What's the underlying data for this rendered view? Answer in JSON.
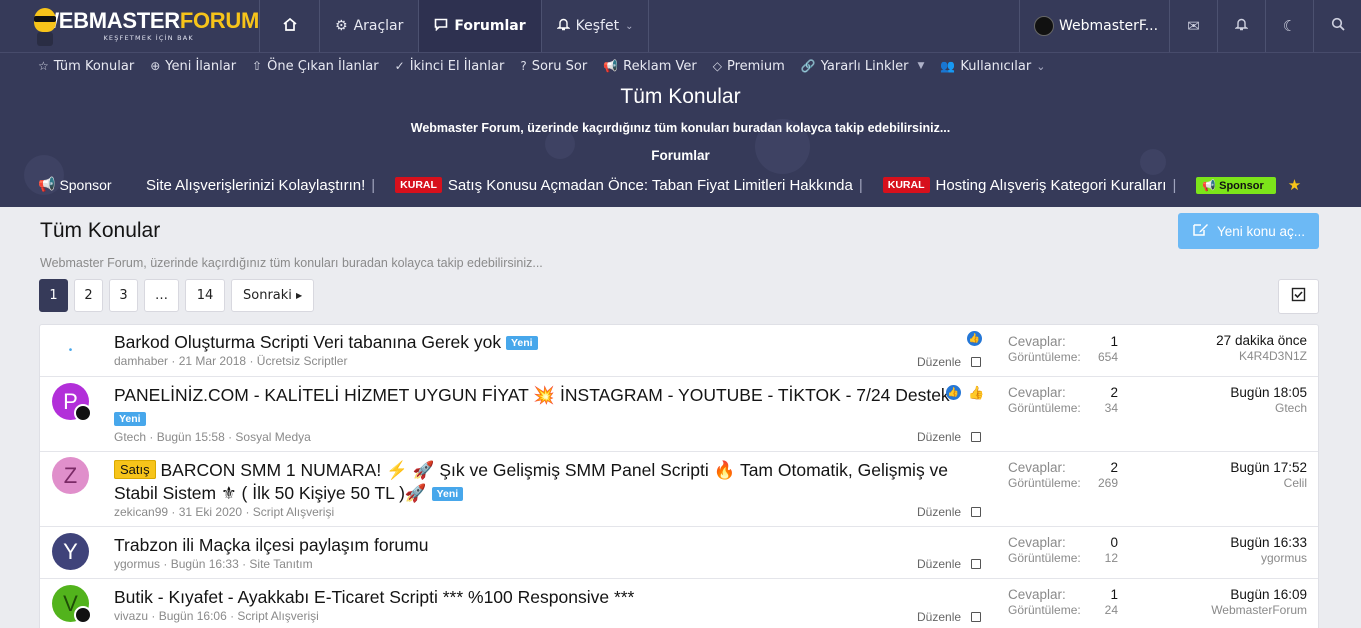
{
  "header": {
    "logo": {
      "part1": "WEBMASTER",
      "part2": "FORUM",
      "tagline": "KEŞFETMEK İÇİN BAK"
    },
    "nav": [
      {
        "label": "Araçlar"
      },
      {
        "label": "Forumlar"
      },
      {
        "label": "Keşfet"
      }
    ],
    "user": "WebmasterF..."
  },
  "subnav": [
    {
      "label": "Tüm Konular",
      "icon": "star-outline-icon"
    },
    {
      "label": "Yeni İlanlar",
      "icon": "plus-circle-icon"
    },
    {
      "label": "Öne Çıkan İlanlar",
      "icon": "arrow-up-circle-icon"
    },
    {
      "label": "İkinci El İlanlar",
      "icon": "check-circle-icon"
    },
    {
      "label": "Soru Sor",
      "icon": "question-circle-icon"
    },
    {
      "label": "Reklam Ver",
      "icon": "megaphone-icon"
    },
    {
      "label": "Premium",
      "icon": "diamond-icon"
    },
    {
      "label": "Yararlı Linkler",
      "icon": "link-icon"
    },
    {
      "label": "Kullanıcılar",
      "icon": "users-icon"
    }
  ],
  "hero": {
    "title": "Tüm Konular",
    "description": "Webmaster Forum, üzerinde kaçırdığınız tüm konuları buradan kolayca takip edebilirsiniz...",
    "breadcrumb": "Forumlar"
  },
  "ticker": {
    "sponsor_label": "Sponsor",
    "items": [
      {
        "text": "Site Alışverişlerinizi Kolaylaştırın!"
      },
      {
        "badge": "KURAL",
        "text": "Satış Konusu Açmadan Önce: Taban Fiyat Limitleri Hakkında"
      },
      {
        "badge": "KURAL",
        "text": "Hosting Alışveriş Kategori Kuralları"
      }
    ],
    "sponsor_badge": "Sponsor"
  },
  "page": {
    "title": "Tüm Konular",
    "description": "Webmaster Forum, üzerinde kaçırdığınız tüm konuları buradan kolayca takip edebilirsiniz...",
    "new_thread_button": "Yeni konu aç..."
  },
  "pagination": {
    "pages": [
      "1",
      "2",
      "3",
      "…",
      "14"
    ],
    "current": "1",
    "next": "Sonraki"
  },
  "threads": [
    {
      "title": "Barkod Oluşturma Scripti Veri tabanına Gerek yok",
      "prefix": "",
      "new_badge": "Yeni",
      "author": "damhaber",
      "date": "21 Mar 2018",
      "category": "Ücretsiz Scriptler",
      "edit_label": "Düzenle",
      "replies_label": "Cevaplar:",
      "replies": "1",
      "views_label": "Görüntüleme:",
      "views": "654",
      "last_time": "27 dakika önce",
      "last_user": "K4R4D3N1Z",
      "avatar_letter": "",
      "avatar_color": "#ffffff"
    },
    {
      "title": "PANELİNİZ.COM - KALİTELİ HİZMET UYGUN FİYAT 💥 İNSTAGRAM - YOUTUBE - TİKTOK - 7/24 Destek",
      "prefix": "",
      "new_badge": "Yeni",
      "author": "Gtech",
      "date": "Bugün 15:58",
      "category": "Sosyal Medya",
      "edit_label": "Düzenle",
      "replies_label": "Cevaplar:",
      "replies": "2",
      "views_label": "Görüntüleme:",
      "views": "34",
      "last_time": "Bugün 18:05",
      "last_user": "Gtech",
      "avatar_letter": "P",
      "avatar_color": "#b22fd9"
    },
    {
      "title": "BARCON SMM 1 NUMARA! ⚡ 🚀 Şık ve Gelişmiş SMM Panel Scripti 🔥 Tam Otomatik, Gelişmiş ve Stabil Sistem ⚜ ( İlk 50 Kişiye 50 TL )🚀",
      "prefix": "Satış",
      "new_badge": "Yeni",
      "author": "zekican99",
      "date": "31 Eki 2020",
      "category": "Script Alışverişi",
      "edit_label": "Düzenle",
      "replies_label": "Cevaplar:",
      "replies": "2",
      "views_label": "Görüntüleme:",
      "views": "269",
      "last_time": "Bugün 17:52",
      "last_user": "Celil",
      "avatar_letter": "Z",
      "avatar_color": "#e08fcb"
    },
    {
      "title": "Trabzon ili Maçka ilçesi paylaşım forumu",
      "prefix": "",
      "new_badge": "",
      "author": "ygormus",
      "date": "Bugün 16:33",
      "category": "Site Tanıtım",
      "edit_label": "Düzenle",
      "replies_label": "Cevaplar:",
      "replies": "0",
      "views_label": "Görüntüleme:",
      "views": "12",
      "last_time": "Bugün 16:33",
      "last_user": "ygormus",
      "avatar_letter": "Y",
      "avatar_color": "#3f437a"
    },
    {
      "title": "Butik - Kıyafet - Ayakkabı E-Ticaret Scripti *** %100 Responsive ***",
      "prefix": "",
      "new_badge": "",
      "author": "vivazu",
      "date": "Bugün 16:06",
      "category": "Script Alışverişi",
      "edit_label": "Düzenle",
      "replies_label": "Cevaplar:",
      "replies": "1",
      "views_label": "Görüntüleme:",
      "views": "24",
      "last_time": "Bugün 16:09",
      "last_user": "WebmasterForum",
      "avatar_letter": "V",
      "avatar_color": "#52b31c"
    }
  ]
}
